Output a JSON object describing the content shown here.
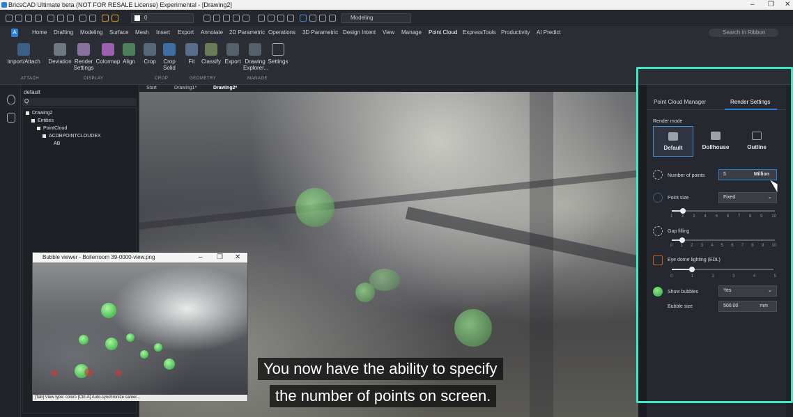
{
  "window": {
    "title": "BricsCAD Ultimate beta (NOT FOR RESALE License) Experimental - [Drawing2]",
    "controls": [
      "–",
      "❐",
      "✕"
    ]
  },
  "qat": {
    "layer_value": "0",
    "workspace": "Modeling"
  },
  "menu_tabs": [
    "Home",
    "Drafting",
    "Modeling",
    "Surface",
    "Mesh",
    "Insert",
    "Export",
    "Annotate",
    "2D Parametric",
    "Operations",
    "3D Parametric",
    "Design Intent",
    "View",
    "Manage",
    "Point Cloud",
    "ExpressTools",
    "Productivity",
    "AI Predict"
  ],
  "search_ribbon": "Search in Ribbon",
  "ribbon": {
    "buttons": [
      "Import/Attach",
      "Deviation",
      "Render Settings",
      "Colormap",
      "Align",
      "Crop",
      "Crop Solid",
      "Fit",
      "Classify",
      "Export",
      "Drawing Explorer...",
      "Settings"
    ],
    "groups": [
      "ATTACH",
      "DISPLAY",
      "CROP",
      "GEOMETRY",
      "MANAGE"
    ]
  },
  "tree": {
    "header": "default",
    "search_placeholder": "Q",
    "nodes": [
      "Drawing2",
      "Entities",
      "PointCloud",
      "ACDBPOINTCLOUDEX",
      "AB"
    ]
  },
  "doc_tabs": [
    "Start",
    "Drawing1*",
    "Drawing2*"
  ],
  "bubble_viewer": {
    "title": "Bubble viewer - Boilerroom 39-0000-view.png",
    "status": "[Tab] View type: colors     [Ctrl-A] Auto-synchronize camer..."
  },
  "subtitles": [
    "You now have the ability to specify",
    "the number of points on screen."
  ],
  "right_panel": {
    "tabs": [
      "Point Cloud Manager",
      "Render Settings"
    ],
    "render_mode_label": "Render mode",
    "modes": [
      "Default",
      "Dollhouse",
      "Outline"
    ],
    "number_of_points_label": "Number of points",
    "number_of_points_value": "5",
    "number_of_points_unit": "Million",
    "point_size_label": "Point size",
    "point_size_value": "Fixed",
    "point_size_ticks": [
      "1",
      "2",
      "3",
      "4",
      "5",
      "6",
      "7",
      "8",
      "9",
      "10"
    ],
    "gap_filling_label": "Gap filling",
    "gap_ticks": [
      "0",
      "1",
      "2",
      "3",
      "4",
      "5",
      "6",
      "7",
      "8",
      "9",
      "10"
    ],
    "edl_label": "Eye dome lighting (EDL)",
    "edl_ticks": [
      "0",
      "1",
      "2",
      "3",
      "4",
      "5"
    ],
    "show_bubbles_label": "Show bubbles",
    "show_bubbles_value": "Yes",
    "bubble_size_label": "Bubble size",
    "bubble_size_value": "500.00",
    "bubble_size_unit": "mm",
    "point_size_level": 0.11,
    "gap_filling_level": 0.1,
    "edl_level": 0.2
  },
  "colors": {
    "accent": "#2b7fd6",
    "highlight": "#3de8c2",
    "bubble_green": "#29a63a"
  }
}
